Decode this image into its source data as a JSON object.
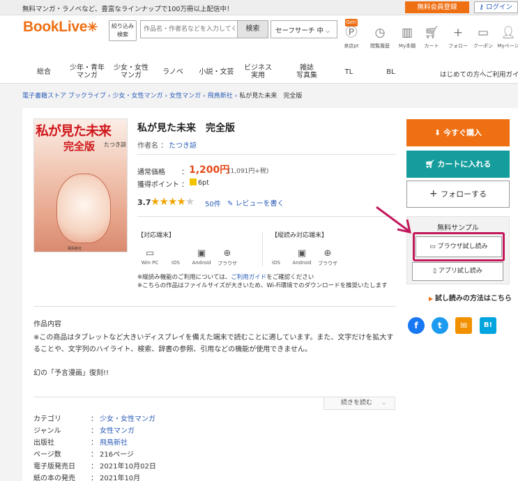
{
  "topbar": {
    "message": "無料マンガ・ラノベなど、豊富なラインナップで100万冊以上配信中！",
    "register": "無料会員登録",
    "login": "ログイン"
  },
  "header": {
    "logo": "BookLive",
    "narrow_line1": "絞り込み",
    "narrow_line2": "検索",
    "search_placeholder": "作品名・作者名などを入力してください",
    "search_button": "検索",
    "safe_search": "セーフサーチ 中",
    "get_badge": "Get!",
    "icons": [
      {
        "name": "来店pt",
        "icon": "point-icon"
      },
      {
        "name": "閲覧履歴",
        "icon": "history-icon"
      },
      {
        "name": "My本棚",
        "icon": "bookshelf-icon"
      },
      {
        "name": "カート",
        "icon": "cart-icon"
      },
      {
        "name": "フォロー",
        "icon": "plus-icon"
      },
      {
        "name": "クーポン",
        "icon": "coupon-icon"
      },
      {
        "name": "Myページ",
        "icon": "user-icon"
      }
    ]
  },
  "nav": {
    "items": [
      {
        "l1": "総合",
        "l2": ""
      },
      {
        "l1": "少年・青年",
        "l2": "マンガ"
      },
      {
        "l1": "少女・女性",
        "l2": "マンガ"
      },
      {
        "l1": "ラノベ",
        "l2": ""
      },
      {
        "l1": "小説・文芸",
        "l2": ""
      },
      {
        "l1": "ビジネス",
        "l2": "実用"
      },
      {
        "l1": "雑誌",
        "l2": "写真集"
      },
      {
        "l1": "TL",
        "l2": ""
      },
      {
        "l1": "BL",
        "l2": ""
      }
    ],
    "first_time": "はじめての方へ",
    "guide": "ご利用ガイド"
  },
  "breadcrumb": [
    "電子書籍ストア ブックライブ",
    "少女・女性マンガ",
    "女性マンガ",
    "飛鳥新社",
    "私が見た未来　完全版"
  ],
  "product": {
    "cover_title": "私が見た未来",
    "cover_subtitle": "完全版",
    "cover_author": "たつき諒",
    "cover_publisher": "飛鳥新社",
    "title": "私が見た未来　完全版",
    "author_label": "作者名 ：",
    "author": "たつき諒",
    "price_label": "通常価格",
    "colon": "：",
    "price": "1,200円",
    "price_tax": "(1,091円+税)",
    "points_label": "獲得ポイント",
    "points": "6pt",
    "rating": "3.7",
    "rating_value": 3.7,
    "review_count": "50件",
    "write_review": "レビューを書く",
    "devices_label": "【対応端末】",
    "vertical_label": "【縦読み対応端末】",
    "devices": [
      "Win PC",
      "iOS",
      "Android",
      "ブラウザ"
    ],
    "vertical_devices": [
      "iOS",
      "Android",
      "ブラウザ"
    ],
    "note1_a": "※縦読み機能のご利用については、",
    "note1_link": "ご利用ガイド",
    "note1_b": "をご確認ください",
    "note2": "※こちらの作品はファイルサイズが大きいため、Wi-Fi環境でのダウンロードを推奨いたします"
  },
  "description": {
    "heading": "作品内容",
    "body": "※この商品はタブレットなど大きいディスプレイを備えた端末で読むことに適しています。また、文字だけを拡大することや、文字列のハイライト、検索、辞書の参照、引用などの機能が使用できません。",
    "body2": "幻の「予言漫画」復刻!!",
    "more": "続きを読む"
  },
  "info": [
    {
      "k": "カテゴリ",
      "v": "少女・女性マンガ",
      "link": true
    },
    {
      "k": "ジャンル",
      "v": "女性マンガ",
      "link": true
    },
    {
      "k": "出版社",
      "v": "飛鳥新社",
      "link": true
    },
    {
      "k": "ページ数",
      "v": "216ページ",
      "link": false
    },
    {
      "k": "電子版発売日",
      "v": "2021年10月02日",
      "link": false
    },
    {
      "k": "紙の本の発売",
      "v": "2021年10月",
      "link": false
    }
  ],
  "sidebar": {
    "buy": "今すぐ購入",
    "cart": "カートに入れる",
    "follow": "フォローする",
    "sample_heading": "無料サンプル",
    "browser_sample": "ブラウザ試し読み",
    "app_sample": "アプリ試し読み",
    "howto": "試し読みの方法はこちら",
    "share": [
      "f",
      "t",
      "✉",
      "B!"
    ]
  },
  "colors": {
    "brand": "#ef6f13",
    "teal": "#149d9c",
    "highlight": "#c2185b",
    "price": "#e64a19"
  }
}
